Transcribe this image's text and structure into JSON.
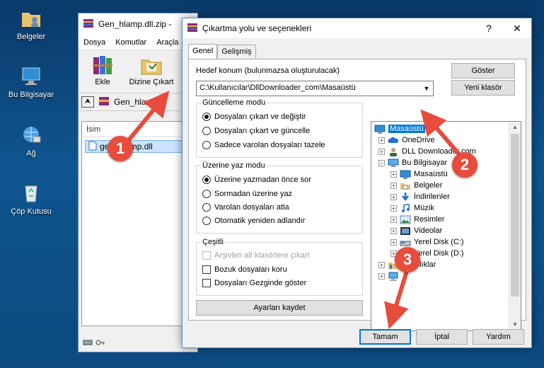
{
  "desktop": {
    "icons": [
      {
        "label": "Belgeler",
        "icon": "folder-user-icon"
      },
      {
        "label": "Bu Bilgisayar",
        "icon": "computer-icon"
      },
      {
        "label": "Ağ",
        "icon": "network-globe-icon"
      },
      {
        "label": "Çöp Kutusu",
        "icon": "recycle-bin-icon"
      }
    ]
  },
  "rar": {
    "title": "Gen_hlamp.dll.zip -",
    "menu": [
      "Dosya",
      "Komutlar",
      "Araçla"
    ],
    "toolbar": {
      "add_label": "Ekle",
      "extract_label": "Dizine Çıkart"
    },
    "address": "Gen_hlamp",
    "column_name": "İsim",
    "file_name": "gen_hlamp.dll"
  },
  "dialog": {
    "title": "Çıkartma yolu ve seçenekleri",
    "help_glyph": "?",
    "close_glyph": "✕",
    "tabs": [
      "Genel",
      "Gelişmiş"
    ],
    "dest_label": "Hedef konum (bulunmazsa oluşturulacak)",
    "dest_value": "C:\\Kullanıcılar\\DllDownloader_com\\Masaüstü",
    "show_button": "Göster",
    "new_folder_button": "Yeni klasör",
    "update_mode": {
      "title": "Güncelleme modu",
      "options": [
        "Dosyaları çıkart ve değiştir",
        "Dosyaları çıkart ve güncelle",
        "Sadece varolan dosyaları tazele"
      ],
      "selected": 0
    },
    "overwrite_mode": {
      "title": "Üzerine yaz modu",
      "options": [
        "Üzerine yazmadan önce sor",
        "Sormadan üzerine yaz",
        "Varolan dosyaları atla",
        "Otomatik yeniden adlandır"
      ],
      "selected": 0
    },
    "misc": {
      "title": "Çeşitli",
      "options": [
        "Arşivleri alt klasörlere çıkart",
        "Bozuk dosyaları koru",
        "Dosyaları Gezginde göster"
      ]
    },
    "save_settings_button": "Ayarları kaydet",
    "tree": [
      {
        "label": "Masaüstü",
        "icon": "desktop-icon",
        "level": 0,
        "expander": "",
        "selected": true
      },
      {
        "label": "OneDrive",
        "icon": "cloud-icon",
        "level": 1,
        "expander": "+"
      },
      {
        "label": "DLL Downloader.com",
        "icon": "user-icon",
        "level": 1,
        "expander": "+"
      },
      {
        "label": "Bu Bilgisayar",
        "icon": "computer-icon",
        "level": 1,
        "expander": "−"
      },
      {
        "label": "Masaüstü",
        "icon": "desktop-icon",
        "level": 2,
        "expander": "+"
      },
      {
        "label": "Belgeler",
        "icon": "document-folder-icon",
        "level": 2,
        "expander": "+"
      },
      {
        "label": "İndirilenler",
        "icon": "download-icon",
        "level": 2,
        "expander": "+"
      },
      {
        "label": "Müzik",
        "icon": "music-icon",
        "level": 2,
        "expander": "+"
      },
      {
        "label": "Resimler",
        "icon": "pictures-icon",
        "level": 2,
        "expander": "+"
      },
      {
        "label": "Videolar",
        "icon": "video-icon",
        "level": 2,
        "expander": "+"
      },
      {
        "label": "Yerel Disk (C:)",
        "icon": "drive-icon",
        "level": 2,
        "expander": "+"
      },
      {
        "label": "Yerel Disk (D:)",
        "icon": "drive-icon",
        "level": 2,
        "expander": "+"
      },
      {
        "label": "Kitaplıklar",
        "icon": "library-icon",
        "level": 1,
        "expander": "+"
      },
      {
        "label": "",
        "icon": "network-icon",
        "level": 1,
        "expander": "+"
      }
    ],
    "ok_button": "Tamam",
    "cancel_button": "İptal",
    "help_button": "Yardım"
  },
  "annotations": [
    {
      "number": "1"
    },
    {
      "number": "2"
    },
    {
      "number": "3"
    }
  ],
  "colors": {
    "marker": "#e74c3c",
    "selection": "#0078d7"
  }
}
